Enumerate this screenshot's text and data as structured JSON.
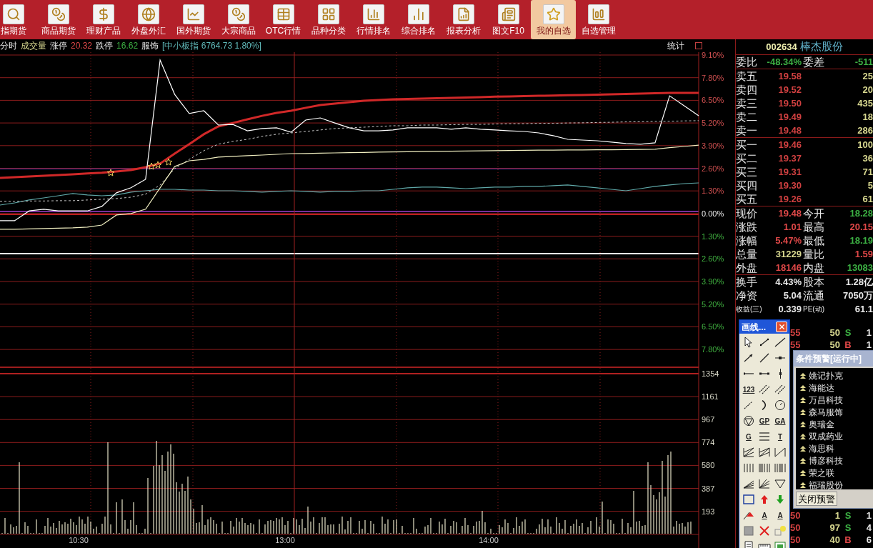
{
  "toolbar": [
    {
      "label": "指期货",
      "selected": false
    },
    {
      "label": "商品期货",
      "selected": false
    },
    {
      "label": "理财产品",
      "selected": false
    },
    {
      "label": "外盘外汇",
      "selected": false
    },
    {
      "label": "国外期货",
      "selected": false
    },
    {
      "label": "大宗商品",
      "selected": false
    },
    {
      "label": "OTC行情",
      "selected": false
    },
    {
      "label": "品种分类",
      "selected": false
    },
    {
      "label": "行情排名",
      "selected": false
    },
    {
      "label": "综合排名",
      "selected": false
    },
    {
      "label": "报表分析",
      "selected": false
    },
    {
      "label": "图文F10",
      "selected": false
    },
    {
      "label": "我的自选",
      "selected": true
    },
    {
      "label": "自选管理",
      "selected": false
    }
  ],
  "info_bar": {
    "items": [
      {
        "text": "分时",
        "kind": "flat"
      },
      {
        "text": "成交量",
        "kind": "vol"
      },
      {
        "text": "涨停",
        "kind": "flat"
      },
      {
        "text": "20.32",
        "kind": "up"
      },
      {
        "text": "跌停",
        "kind": "flat"
      },
      {
        "text": "16.62",
        "kind": "down"
      },
      {
        "text": "服饰",
        "kind": "flat"
      },
      {
        "text": "[中小板指 6764.73 1.80%]",
        "kind": "index"
      }
    ],
    "stats_button": "统计"
  },
  "price_chart": {
    "chart_data": {
      "type": "line",
      "ylim": [
        -7.8,
        9.1
      ],
      "grid": true,
      "yticks": [
        {
          "value": 9.1,
          "label": "9.10%"
        },
        {
          "value": 7.8,
          "label": "7.80%"
        },
        {
          "value": 6.5,
          "label": "6.50%"
        },
        {
          "value": 5.2,
          "label": "5.20%"
        },
        {
          "value": 3.9,
          "label": "3.90%"
        },
        {
          "value": 2.6,
          "label": "2.60%"
        },
        {
          "value": 1.3,
          "label": "1.30%"
        },
        {
          "value": 0,
          "label": "0.00%"
        }
      ],
      "series": [
        {
          "color": "#5fa8a8",
          "values": [
            0.49,
            0.61,
            0.78,
            0.9,
            1.02,
            1.15,
            1.07,
            1.02,
            1.07,
            1.23,
            1.31,
            1.39,
            1.39,
            1.35,
            1.35,
            1.31,
            1.31,
            1.27,
            1.23,
            1.27,
            1.31,
            1.27,
            1.23,
            1.27,
            1.27,
            1.31,
            1.31,
            1.39,
            1.48,
            1.52,
            1.52,
            1.48,
            1.43,
            1.48,
            1.52,
            1.52,
            1.56,
            1.56,
            1.6,
            1.64,
            1.56,
            1.48,
            1.39,
            1.31,
            1.43,
            1.56,
            1.64,
            1.72,
            1.76
          ]
        },
        {
          "color": "#c8c8c8",
          "line_style": "dashed",
          "values": [
            0.7,
            0.7,
            0.72,
            0.72,
            0.74,
            0.74,
            0.78,
            0.82,
            0.86,
            0.94,
            1.11,
            1.64,
            2.58,
            3.11,
            3.61,
            3.98,
            4.14,
            4.26,
            4.43,
            4.55,
            4.63,
            4.71,
            4.8,
            4.88,
            4.92,
            4.96,
            5.0,
            5.04,
            5.04,
            5.08,
            5.08,
            5.1,
            5.12,
            5.12,
            5.14,
            5.16,
            5.16,
            5.18,
            5.18,
            5.2,
            5.21,
            5.23,
            5.24,
            5.26,
            5.27,
            5.29,
            5.3,
            5.32,
            5.33
          ]
        },
        {
          "color": "#f0eec0",
          "values": [
            -0.9,
            -0.9,
            -0.88,
            -0.86,
            -0.84,
            -0.82,
            -0.78,
            -0.66,
            -0.08,
            0,
            0.25,
            1.48,
            2.7,
            3.03,
            3.11,
            3.24,
            3.28,
            3.32,
            3.36,
            3.4,
            3.44,
            3.45,
            3.47,
            3.48,
            3.5,
            3.51,
            3.53,
            3.54,
            3.55,
            3.56,
            3.57,
            3.58,
            3.59,
            3.6,
            3.61,
            3.62,
            3.63,
            3.64,
            3.64,
            3.65,
            3.65,
            3.66,
            3.66,
            3.67,
            3.68,
            3.69,
            3.78,
            3.85,
            3.93
          ]
        },
        {
          "color": "#d02828",
          "values": [
            2.05,
            2.09,
            2.13,
            2.17,
            2.21,
            2.25,
            2.3,
            2.34,
            2.42,
            2.5,
            2.66,
            2.87,
            3.44,
            3.98,
            4.55,
            5.0,
            5.2,
            5.41,
            5.61,
            5.78,
            5.9,
            6.07,
            6.23,
            6.31,
            6.39,
            6.48,
            6.52,
            6.56,
            6.58,
            6.6,
            6.62,
            6.64,
            6.66,
            6.68,
            6.71,
            6.72,
            6.74,
            6.76,
            6.77,
            6.79,
            6.8,
            6.82,
            6.84,
            6.86,
            6.89,
            6.91,
            6.93,
            6.93,
            6.93
          ]
        },
        {
          "color": "#ffffff",
          "values": [
            -0.41,
            -0.41,
            0.15,
            0.25,
            0.15,
            0.15,
            0.15,
            0.41,
            1.19,
            1.48,
            1.97,
            8.81,
            6.84,
            5.74,
            5.9,
            5.08,
            5.12,
            4.75,
            4.88,
            4.92,
            4.67,
            5.37,
            5.49,
            5.2,
            4.92,
            4.75,
            4.75,
            4.8,
            4.92,
            4.92,
            4.92,
            4.84,
            4.92,
            4.84,
            4.8,
            4.75,
            4.71,
            4.63,
            4.47,
            4.26,
            4.22,
            4.18,
            4.1,
            4.02,
            3.98,
            4.06,
            6.76,
            6.19,
            5.61
          ]
        }
      ]
    },
    "lower_axis": [
      {
        "label": "1.30%",
        "kind": "down"
      },
      {
        "label": "2.60%",
        "kind": "down"
      },
      {
        "label": "3.90%",
        "kind": "down"
      },
      {
        "label": "5.20%",
        "kind": "down"
      },
      {
        "label": "6.50%",
        "kind": "down"
      },
      {
        "label": "7.80%",
        "kind": "down"
      }
    ],
    "volume_axis": [
      "1354",
      "1161",
      "967",
      "774",
      "580",
      "387",
      "193"
    ],
    "time_axis": [
      "10:30",
      "13:00",
      "14:00"
    ]
  },
  "quote": {
    "code": "002634",
    "name": "棒杰股份",
    "ratio": [
      {
        "text": "委比",
        "kind": "label"
      },
      {
        "text": "-48.34%",
        "kind": "down"
      },
      {
        "text": "委差",
        "kind": "label"
      },
      {
        "text": "-511",
        "kind": "down"
      }
    ],
    "sells": [
      {
        "label": "卖五",
        "price": "19.58",
        "volume": "25"
      },
      {
        "label": "卖四",
        "price": "19.52",
        "volume": "20"
      },
      {
        "label": "卖三",
        "price": "19.50",
        "volume": "435"
      },
      {
        "label": "卖二",
        "price": "19.49",
        "volume": "18"
      },
      {
        "label": "卖一",
        "price": "19.48",
        "volume": "286"
      }
    ],
    "buys": [
      {
        "label": "买一",
        "price": "19.46",
        "volume": "100"
      },
      {
        "label": "买二",
        "price": "19.37",
        "volume": "36"
      },
      {
        "label": "买三",
        "price": "19.31",
        "volume": "71"
      },
      {
        "label": "买四",
        "price": "19.30",
        "volume": "5"
      },
      {
        "label": "买五",
        "price": "19.26",
        "volume": "61"
      }
    ],
    "stats": [
      [
        {
          "text": "现价",
          "kind": "label"
        },
        {
          "text": "19.48",
          "kind": "up"
        },
        {
          "text": "今开",
          "kind": "label"
        },
        {
          "text": "18.28",
          "kind": "down"
        }
      ],
      [
        {
          "text": "涨跌",
          "kind": "label"
        },
        {
          "text": "1.01",
          "kind": "up"
        },
        {
          "text": "最高",
          "kind": "label"
        },
        {
          "text": "20.15",
          "kind": "up"
        }
      ],
      [
        {
          "text": "涨幅",
          "kind": "label"
        },
        {
          "text": "5.47%",
          "kind": "up"
        },
        {
          "text": "最低",
          "kind": "label"
        },
        {
          "text": "18.19",
          "kind": "down"
        }
      ],
      [
        {
          "text": "总量",
          "kind": "label"
        },
        {
          "text": "31229",
          "kind": "vol"
        },
        {
          "text": "量比",
          "kind": "label"
        },
        {
          "text": "1.59",
          "kind": "up"
        }
      ],
      [
        {
          "text": "外盘",
          "kind": "label"
        },
        {
          "text": "18146",
          "kind": "up"
        },
        {
          "text": "内盘",
          "kind": "label"
        },
        {
          "text": "13083",
          "kind": "down"
        }
      ]
    ],
    "info": [
      [
        {
          "text": "换手",
          "kind": "label"
        },
        {
          "text": "4.43%",
          "kind": "flat"
        },
        {
          "text": "股本",
          "kind": "label"
        },
        {
          "text": "1.28亿",
          "kind": "flat"
        }
      ],
      [
        {
          "text": "净资",
          "kind": "label"
        },
        {
          "text": "5.04",
          "kind": "flat"
        },
        {
          "text": "流通",
          "kind": "label"
        },
        {
          "text": "7050万",
          "kind": "flat"
        }
      ],
      [
        {
          "text": "收益(三)",
          "kind": "label"
        },
        {
          "text": "0.339",
          "kind": "flat"
        },
        {
          "text": "PE(动)",
          "kind": "label"
        },
        {
          "text": "61.1",
          "kind": "flat"
        }
      ]
    ]
  },
  "trades_top": [
    {
      "price": "55",
      "volume": "50",
      "side": "S",
      "kind": "sell",
      "count": "1"
    },
    {
      "price": "55",
      "volume": "50",
      "side": "B",
      "kind": "buy",
      "count": "1"
    }
  ],
  "trades_bottom": [
    {
      "price": "50",
      "volume": "1",
      "side": "S",
      "kind": "sell",
      "count": "1"
    },
    {
      "price": "50",
      "volume": "97",
      "side": "S",
      "kind": "sell",
      "count": "4"
    },
    {
      "price": "50",
      "volume": "40",
      "side": "B",
      "kind": "buy",
      "count": "6"
    }
  ],
  "draw_window": {
    "title": "画线...",
    "tool_labels": [
      "123",
      "GP",
      "GA",
      "G",
      "T",
      "A",
      "A"
    ]
  },
  "alert_window": {
    "title": "条件预警[运行中]",
    "items": [
      "姚记扑克",
      "海能达",
      "万昌科技",
      "森马服饰",
      "奥瑞金",
      "双成药业",
      "海思科",
      "博彦科技",
      "荣之联",
      "福瑞股份"
    ],
    "button": "关闭预警"
  }
}
